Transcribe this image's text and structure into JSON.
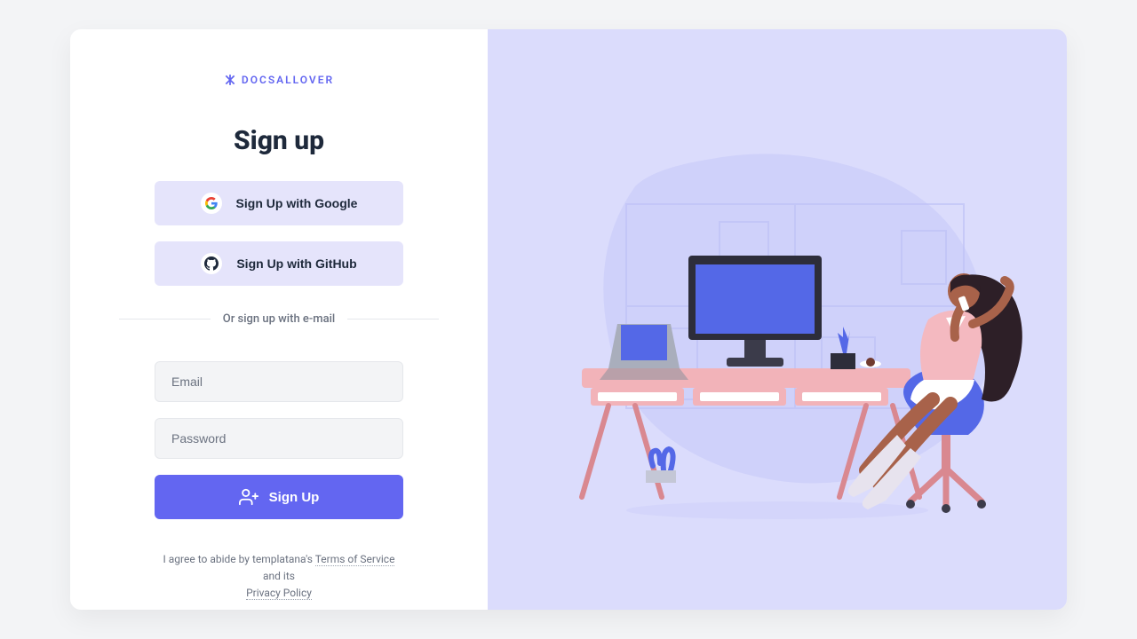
{
  "brand": {
    "name": "DOCSALLOVER"
  },
  "heading": "Sign up",
  "oauth": {
    "google": "Sign Up with Google",
    "github": "Sign Up with GitHub"
  },
  "divider": "Or sign up with e-mail",
  "form": {
    "email_placeholder": "Email",
    "password_placeholder": "Password",
    "submit": "Sign Up"
  },
  "legal": {
    "prefix": "I agree to abide by templatana's ",
    "tos": "Terms of Service",
    "mid": " and its ",
    "privacy": "Privacy Policy"
  }
}
